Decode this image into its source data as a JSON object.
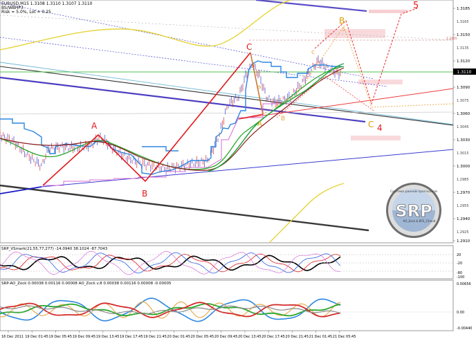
{
  "header": {
    "symbol_line": "EURUSD,M15  1.3108 1.3110 1.3107 1.3110",
    "indicator_line": "BS/WBHP3",
    "risk_line": "Risk = 5.0%, Lot = 0.25"
  },
  "price_axis": {
    "ticks": [
      "1.3185",
      "1.3150",
      "1.3120",
      "1.3090",
      "1.3060",
      "1.3030",
      "1.3000",
      "1.2970",
      "1.2940",
      "1.2910"
    ],
    "ticks_extra": [
      "1.3165",
      "1.3135",
      "1.3105",
      "1.3075",
      "1.3045",
      "1.3015",
      "1.2985",
      "1.2955",
      "1.2925"
    ],
    "current_price": "1.3110",
    "level_tag": "1.3165"
  },
  "waves": {
    "A1": "A",
    "B1": "B",
    "C1": "C",
    "A2": "A",
    "B2": "B",
    "C2": "C",
    "c_small": "c",
    "a_small": "a",
    "b_small": "b",
    "wave4_letter": "C",
    "wave4": "4",
    "wave5": "5",
    "B_top": "B",
    "five_small": "5"
  },
  "logo": {
    "text": "SRP",
    "ring_text": "Система ранней прогнозной",
    "sub_text": "AO_Zock & BFS_15mult"
  },
  "sub1": {
    "label": "SRP_VSmark(21,55,77,277) -14.0940  38.1024 -87.7043",
    "ticks": [
      "20",
      "-20",
      "-80",
      "-100"
    ]
  },
  "sub2": {
    "label": "SRP-AO_Zock  0.00038  0.00116  0.00008   AO_Zock  v.8  0.00038  0.00116  0.00008  -0.00005",
    "ticks": [
      "0.00656",
      "0.00",
      "-0.00440"
    ]
  },
  "time_axis": [
    "16 Dec 2011",
    "19 Dec 01:45",
    "19 Dec 05:45",
    "19 Dec 09:45",
    "19 Dec 13:45",
    "19 Dec 17:45",
    "19 Dec 21:45",
    "20 Dec 01:45",
    "20 Dec 05:45",
    "20 Dec 09:45",
    "20 Dec 13:45",
    "20 Dec 17:45",
    "20 Dec 21:45",
    "21 Dec 01:45",
    "21 Dec 05:45"
  ],
  "colors": {
    "wave_red": "#e0181b",
    "wave_orange": "#d9a100",
    "forecast_pink": "#f4c6c9",
    "trend_blue": "#3434c8",
    "green_ma": "#22a52c",
    "yellow": "#e6d43a"
  }
}
